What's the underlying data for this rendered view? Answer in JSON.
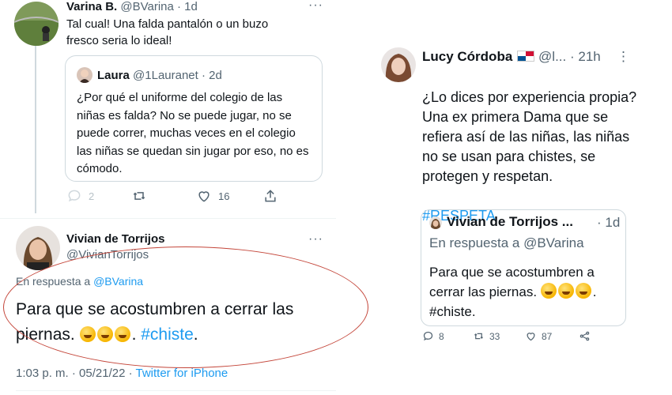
{
  "tweet_varina": {
    "name": "Varina B.",
    "handle": "@BVarina · 1d",
    "text": "Tal cual! Una falda pantalón o un buzo fresco seria lo ideal!",
    "more": "···"
  },
  "quote_laura": {
    "name": "Laura",
    "handle": "@1Lauranet · 2d",
    "text": "¿Por qué el uniforme del colegio de las niñas es falda? No se puede jugar, no se puede correr, muchas veces en el colegio las niñas se quedan sin jugar por eso, no es cómodo."
  },
  "varina_actions": {
    "replies": "2",
    "likes": "16"
  },
  "tweet_vivian": {
    "name": "Vivian de Torrijos",
    "handle": "@VivianTorrijos",
    "more": "···",
    "reply_prefix": "En respuesta a",
    "reply_to": "@BVarina",
    "text": "Para que se acostumbren a cerrar las piernas.",
    "hashtag": "#chiste",
    "period": ".",
    "meta_time": "1:03 p. m. · 05/21/22 ·",
    "meta_source": "Twitter for iPhone"
  },
  "tweet_lucy": {
    "name": "Lucy Córdoba",
    "handle": "@l...",
    "time": "· 21h",
    "more": "⋮",
    "text": "¿Lo dices por experiencia propia?\nUna ex primera Dama que se refiera así de las niñas, las niñas no se usan para chistes, se protegen y respetan.",
    "hashtag": "#RESPETA",
    "quote": {
      "name": "Vivian de Torrijos ...",
      "time": "· 1d",
      "reply_line": "En respuesta a @BVarina",
      "text": "Para que se acostumbren a cerrar las piernas.",
      "hashtag": "#chiste."
    },
    "actions": {
      "replies": "8",
      "retweets": "33",
      "likes": "87"
    }
  }
}
